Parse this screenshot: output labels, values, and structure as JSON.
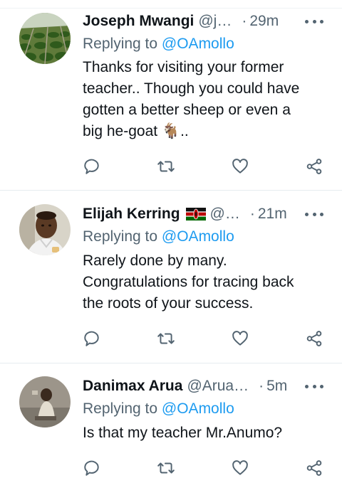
{
  "tweets": [
    {
      "name": "Joseph Mwangi",
      "handle": "@j…",
      "dot": "·",
      "time": "29m",
      "replying_prefix": "Replying to",
      "replying_to": "@OAmollo",
      "text_lines": [
        "Thanks for visiting your former",
        "teacher.. Though you could have",
        "gotten a better sheep or even a",
        "big he-goat 🐐.."
      ],
      "avatar": "crop-field-photo"
    },
    {
      "name": "Elijah Kerring",
      "handle": "@…",
      "dot": "·",
      "time": "21m",
      "flag": "kenya-flag-icon",
      "replying_prefix": "Replying to",
      "replying_to": "@OAmollo",
      "text_lines": [
        "Rarely done by many.",
        "Congratulations for tracing back",
        "the roots of your success."
      ],
      "avatar": "man-portrait-photo"
    },
    {
      "name": "Danimax Arua",
      "handle": "@Arua…",
      "dot": "·",
      "time": "5m",
      "replying_prefix": "Replying to",
      "replying_to": "@OAmollo",
      "text_lines": [
        "Is that my teacher Mr.Anumo?"
      ],
      "avatar": "child-photo"
    }
  ],
  "action_icons": [
    "reply-icon",
    "retweet-icon",
    "like-icon",
    "share-icon"
  ],
  "colors": {
    "link": "#1d9bf0",
    "muted": "#536471",
    "text": "#0f1419",
    "divider": "#e6ecf0"
  }
}
